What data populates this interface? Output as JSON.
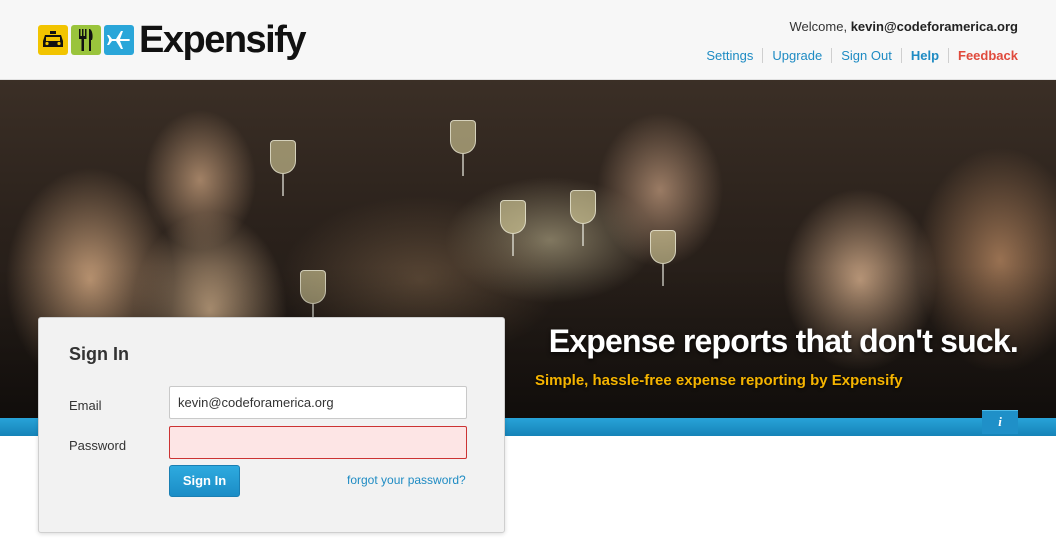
{
  "header": {
    "logo_text": "Expensify",
    "welcome_prefix": "Welcome,",
    "welcome_user": "kevin@codeforamerica.org",
    "nav": [
      "Settings",
      "Upgrade",
      "Sign Out",
      "Help",
      "Feedback"
    ]
  },
  "hero": {
    "headline": "Expense reports that don't suck.",
    "subline": "Simple, hassle-free expense reporting by Expensify",
    "info_label": "i"
  },
  "signin": {
    "title": "Sign In",
    "email_label": "Email",
    "email_value": "kevin@codeforamerica.org",
    "password_label": "Password",
    "password_value": "",
    "button_label": "Sign In",
    "forgot_link": "forgot your password?"
  },
  "colors": {
    "accent": "#1e8bc3",
    "feedback": "#e04a3c",
    "subline": "#f5b400",
    "bar": "#1f90c8"
  }
}
